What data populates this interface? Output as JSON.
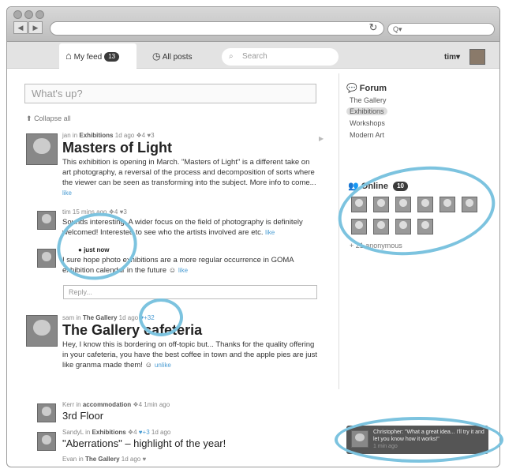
{
  "browser": {
    "search_placeholder": "Q▾"
  },
  "header": {
    "tabs": [
      {
        "label": "My feed",
        "badge": "13"
      },
      {
        "label": "All posts"
      }
    ],
    "search_placeholder": "Search",
    "user": "tim▾"
  },
  "composer": {
    "placeholder": "What's up?"
  },
  "collapse_label": "Collapse all",
  "posts": [
    {
      "author": "jan",
      "in": "in",
      "group": "Exhibitions",
      "time": "1d ago",
      "comments": "4",
      "likes": "3",
      "title": "Masters of Light",
      "text": "This exhibition is opening in March. \"Masters of Light\" is a different take on art photography, a reversal of the process and decomposition of sorts where the viewer can be seen as transforming into the subject. More info to come...",
      "like": "like",
      "replies": [
        {
          "author": "tim",
          "time": "15 mins ago",
          "comments": "4",
          "likes": "3",
          "text": "Sounds interesting. A wider focus on the field of photography is definitely welcomed! Interested to see who the artists involved are etc.",
          "like": "like"
        },
        {
          "time": "just now",
          "text": "I sure hope photo exhibitions are a more regular occurrence in GOMA exhibition calendar in the future ☺",
          "like": "like"
        }
      ],
      "reply_placeholder": "Reply..."
    },
    {
      "author": "sam",
      "in": "in",
      "group": "The Gallery",
      "time": "1d ago",
      "likes": "+32",
      "title": "The Gallery cafeteria",
      "text": "Hey, I know this is bordering on off-topic but... Thanks for the quality offering in your cafeteria, you have the best coffee in town and the apple pies are just like granma made them! ☺",
      "like": "unlike"
    },
    {
      "author": "Kerr",
      "in": "in",
      "group": "accommodation",
      "comments": "4",
      "time": "1min ago",
      "title": "3rd Floor"
    },
    {
      "author": "SandyL",
      "in": "in",
      "group": "Exhibitions",
      "comments": "4",
      "likes": "+3",
      "time": "1d ago",
      "title": "\"Aberrations\" – highlight of the year!"
    },
    {
      "author": "Evan",
      "in": "in",
      "group": "The Gallery",
      "time": "1d ago"
    }
  ],
  "sidebar": {
    "forum_title": "Forum",
    "forum_items": [
      "The Gallery",
      "Exhibitions",
      "Workshops",
      "Modern Art"
    ],
    "online_title": "Online",
    "online_count": "10",
    "anonymous": "+ 21 anonymous"
  },
  "chat": {
    "text": "Christopher: \"What a great idea... I'll try it and let you know how it works!\"",
    "time": "1 min ago"
  },
  "colors": {
    "accent": "#4a9cd3",
    "highlight": "#7cc3df"
  }
}
